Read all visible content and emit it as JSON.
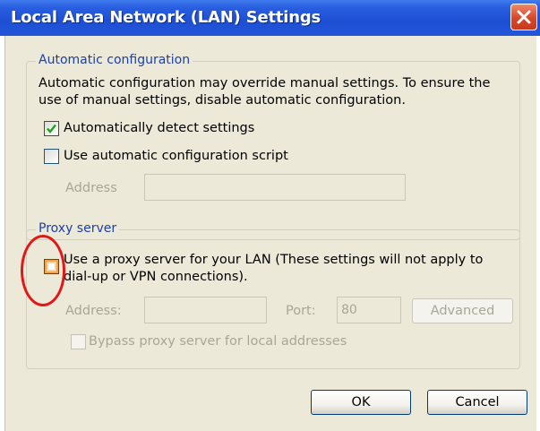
{
  "window": {
    "title": "Local Area Network (LAN) Settings",
    "close_icon": "close-icon"
  },
  "auto_config": {
    "group_label": "Automatic configuration",
    "description_line1": "Automatic configuration may override manual settings.  To ensure the",
    "description_line2": "use of manual settings, disable automatic configuration.",
    "auto_detect_label": "Automatically detect settings",
    "auto_detect_checked": true,
    "script_label": "Use automatic configuration script",
    "script_checked": false,
    "address_label": "Address",
    "address_value": ""
  },
  "proxy": {
    "group_label": "Proxy server",
    "use_proxy_line1": "Use a proxy server for your LAN (These settings will not apply to",
    "use_proxy_line2": "dial-up or VPN connections).",
    "use_proxy_checked": false,
    "address_label": "Address:",
    "address_value": "",
    "port_label": "Port:",
    "port_value": "80",
    "advanced_label": "Advanced",
    "bypass_label": "Bypass proxy server for local addresses",
    "bypass_checked": false
  },
  "buttons": {
    "ok_label": "OK",
    "cancel_label": "Cancel"
  },
  "colors": {
    "titlebar": "#2456d6",
    "dialog_bg": "#ece9d8",
    "group_label": "#1c3fa8",
    "highlight_circle": "#e01818",
    "check_mark": "#21a121"
  }
}
